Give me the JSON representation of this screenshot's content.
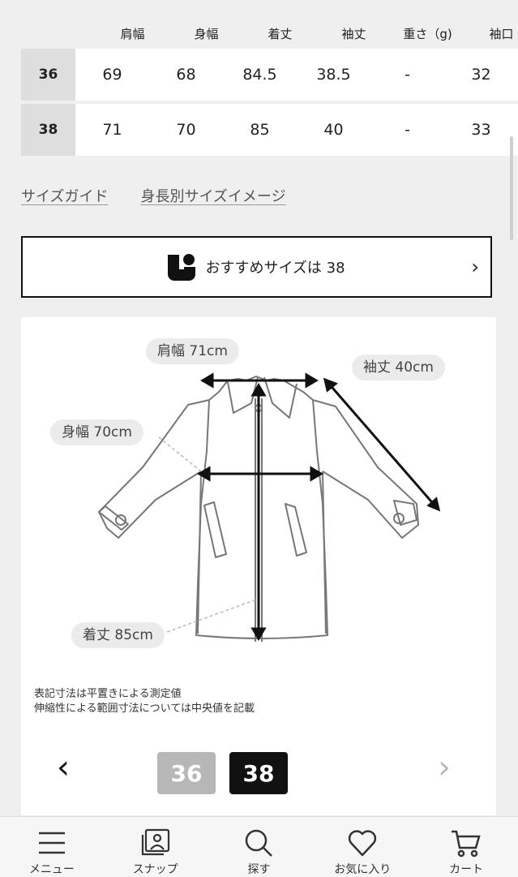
{
  "table": {
    "headers": [
      "",
      "肩幅",
      "身幅",
      "着丈",
      "袖丈",
      "重さ（g)",
      "袖口"
    ],
    "rows": [
      {
        "size": "36",
        "values": [
          "69",
          "68",
          "84.5",
          "38.5",
          "-",
          "32"
        ]
      },
      {
        "size": "38",
        "values": [
          "71",
          "70",
          "85",
          "40",
          "-",
          "33"
        ]
      }
    ]
  },
  "links": {
    "size_guide": "サイズガイド",
    "height_image": "身長別サイズイメージ"
  },
  "recommend": {
    "label": "おすすめサイズは 38"
  },
  "diagram": {
    "shoulder": "肩幅 71cm",
    "sleeve": "袖丈 40cm",
    "body_width": "身幅 70cm",
    "length": "着丈 85cm",
    "note_line1": "表記寸法は平置きによる測定値",
    "note_line2": "伸縮性による範囲寸法については中央値を記載"
  },
  "size_selector": {
    "options": [
      "36",
      "38"
    ],
    "selected": "38"
  },
  "tabbar": {
    "menu": "メニュー",
    "snap": "スナップ",
    "search": "探す",
    "favorites": "お気に入り",
    "cart": "カート"
  }
}
